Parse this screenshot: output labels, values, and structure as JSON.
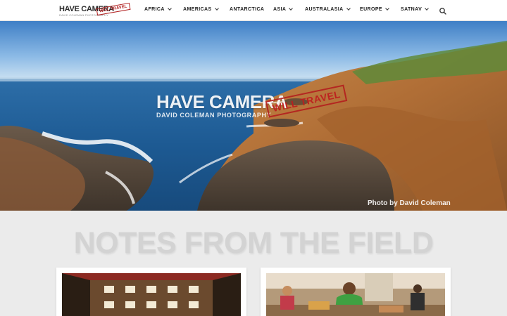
{
  "logo": {
    "name": "HAVE CAMERA",
    "stamp": "WILL TRAVEL",
    "tagline": "DAVID COLEMAN PHOTOGRAPHY"
  },
  "nav": {
    "items": [
      {
        "label": "AFRICA",
        "has_dropdown": true
      },
      {
        "label": "AMERICAS",
        "has_dropdown": true
      },
      {
        "label": "ANTARCTICA",
        "has_dropdown": false
      },
      {
        "label": "ASIA",
        "has_dropdown": true
      },
      {
        "label": "AUSTRALASIA",
        "has_dropdown": true
      },
      {
        "label": "EUROPE",
        "has_dropdown": true
      },
      {
        "label": "SATNAV",
        "has_dropdown": true
      }
    ],
    "search_icon": "search-icon"
  },
  "hero": {
    "title": "HAVE CAMERA",
    "subtitle": "DAVID COLEMAN PHOTOGRAPHY",
    "stamp": "WILL TRAVEL",
    "credit": "Photo by David Coleman"
  },
  "section": {
    "title": "NOTES FROM THE FIELD"
  },
  "cards": [
    {
      "image": "ornate-ceiling-photo"
    },
    {
      "image": "market-vendor-photo"
    }
  ],
  "colors": {
    "background": "#ebebeb",
    "header": "#ffffff",
    "stamp_red": "#b22222",
    "section_title": "#d3d3d3"
  }
}
